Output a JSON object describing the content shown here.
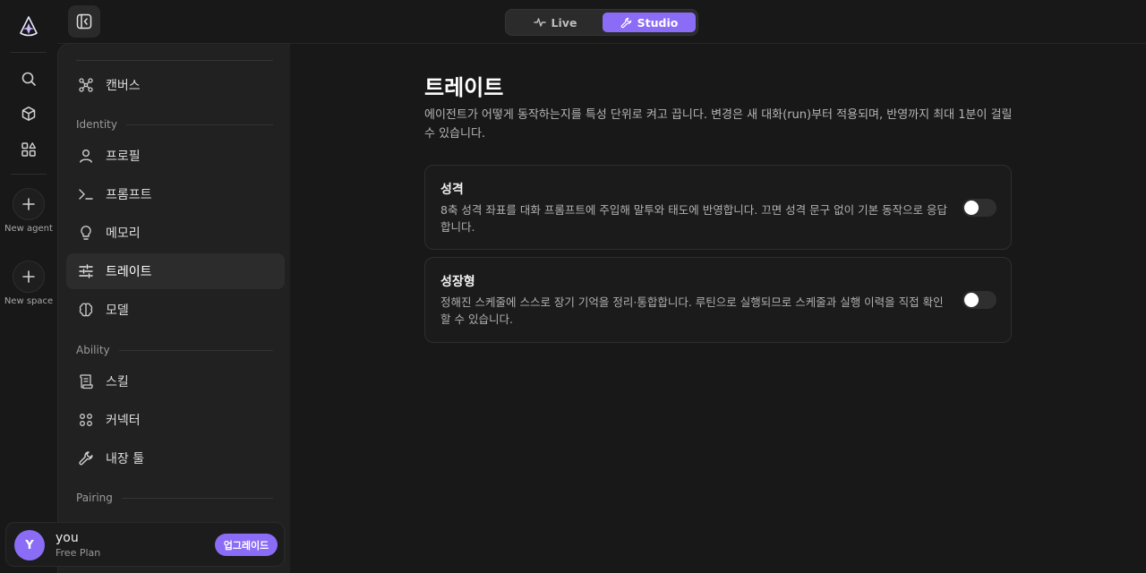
{
  "rail": {
    "new_agent_label": "New agent",
    "new_space_label": "New space"
  },
  "mode_switch": {
    "live_label": "Live",
    "studio_label": "Studio",
    "active": "Studio"
  },
  "sidebar": {
    "canvas_label": "캔버스",
    "sections": {
      "identity": "Identity",
      "ability": "Ability",
      "pairing": "Pairing"
    },
    "identity_items": [
      "프로필",
      "프롬프트",
      "메모리",
      "트레이트",
      "모델"
    ],
    "ability_items": [
      "스킬",
      "커넥터",
      "내장 툴"
    ],
    "active_item": "트레이트"
  },
  "user": {
    "avatar_letter": "Y",
    "name": "you",
    "plan": "Free Plan",
    "upgrade_label": "업그레이드"
  },
  "main": {
    "title": "트레이트",
    "description": "에이전트가 어떻게 동작하는지를 특성 단위로 켜고 끕니다. 변경은 새 대화(run)부터 적용되며, 반영까지 최대 1분이 걸릴 수 있습니다.",
    "traits": [
      {
        "title": "성격",
        "description": "8축 성격 좌표를 대화 프롬프트에 주입해 말투와 태도에 반영합니다. 끄면 성격 문구 없이 기본 동작으로 응답합니다.",
        "enabled": false
      },
      {
        "title": "성장형",
        "description": "정해진 스케줄에 스스로 장기 기억을 정리·통합합니다. 루틴으로 실행되므로 스케줄과 실행 이력을 직접 확인할 수 있습니다.",
        "enabled": false
      }
    ]
  },
  "colors": {
    "accent": "#8b6cf6",
    "background": "#181818",
    "panel": "#212121"
  }
}
